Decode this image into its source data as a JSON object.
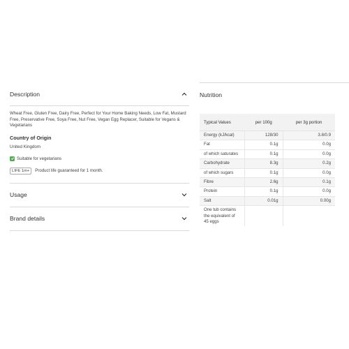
{
  "description": {
    "title": "Description",
    "text": "Wheat Free, Gluten Free, Dairy Free, Perfect for Your Home Baking Needs, Low Fat, Mustard Free, Preservative Free, Soya Free, Nut Free, Vegan Egg Replacer, Suitable for Vegans & Vegetarians",
    "origin_heading": "Country of Origin",
    "origin_value": "United Kingdom",
    "vegetarian": "Suitable for vegetarians",
    "life_badge": "LIFE 1m+",
    "life_text": "Product life guaranteed for 1 month."
  },
  "usage": {
    "title": "Usage"
  },
  "brand": {
    "title": "Brand details"
  },
  "nutrition": {
    "title": "Nutrition",
    "headers": [
      "Typical Values",
      "per 100g",
      "per 3g portion"
    ],
    "rows": [
      [
        "Energy (kJ/kcal)",
        "128/30",
        "3.8/0.9"
      ],
      [
        "Fat",
        "0.1g",
        "0.0g"
      ],
      [
        "of which saturates",
        "0.1g",
        "0.0g"
      ],
      [
        "Carbohydrate",
        "8.3g",
        "0.2g"
      ],
      [
        "of which sugars",
        "0.1g",
        "0.0g"
      ],
      [
        "Fibre",
        "2.6g",
        "0.1g"
      ],
      [
        "Protein",
        "0.1g",
        "0.0g"
      ],
      [
        "Salt",
        "0.01g",
        "0.00g"
      ],
      [
        "One tub contains the equivalent of 45 eggs",
        "",
        ""
      ]
    ]
  },
  "icons": {
    "collapse": "chevron-up-icon",
    "expand": "chevron-down-icon",
    "vegetarian": "check-square-icon"
  },
  "colors": {
    "vegetarian_badge": "#4caf50"
  }
}
